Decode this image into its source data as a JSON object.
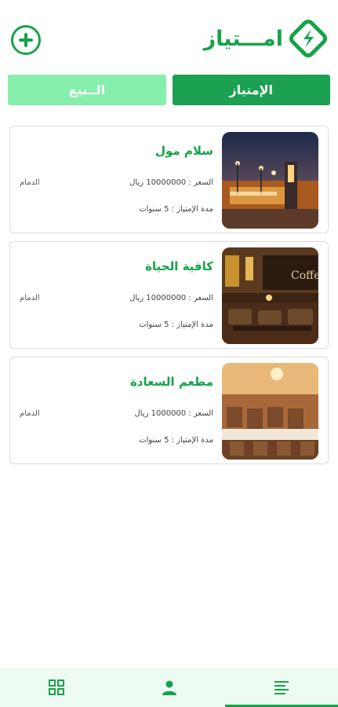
{
  "app": {
    "logo_text": "امـــتياز",
    "brand_color": "#16a34a"
  },
  "tabs": [
    {
      "label": "الــبيع",
      "active": false
    },
    {
      "label": "الإمتياز",
      "active": true
    }
  ],
  "listings": [
    {
      "title": "سلام مول",
      "price": "السعر : 10000000 ريال",
      "city": "الدمام",
      "duration": "مدة الإمتياز : 5 سنوات",
      "image": "mall-night-photo"
    },
    {
      "title": "كافية الحياة",
      "price": "السعر : 10000000 ريال",
      "city": "الدمام",
      "duration": "مدة الإمتياز : 5 سنوات",
      "image": "cafe-interior-photo"
    },
    {
      "title": "مطعم السعادة",
      "price": "السعر : 1000000 ريال",
      "city": "الدمام",
      "duration": "مدة الإمتياز : 5 سنوات",
      "image": "restaurant-dining-hall-photo"
    }
  ],
  "bottom_nav": [
    {
      "icon": "grid-icon",
      "active": false
    },
    {
      "icon": "person-icon",
      "active": false
    },
    {
      "icon": "list-icon",
      "active": true
    }
  ]
}
